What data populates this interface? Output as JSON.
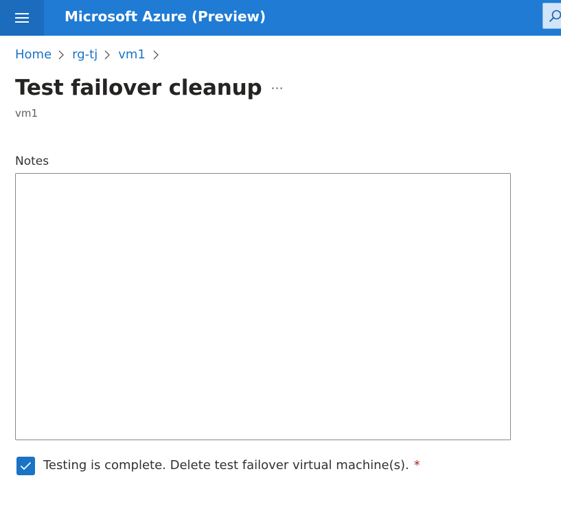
{
  "header": {
    "app_title": "Microsoft Azure (Preview)",
    "menu_icon": "hamburger-icon",
    "search_icon": "search-icon",
    "brand_color": "#1f7bd3"
  },
  "breadcrumb": {
    "items": [
      {
        "label": "Home"
      },
      {
        "label": "rg-tj"
      },
      {
        "label": "vm1"
      }
    ],
    "separator_icon": "chevron-right-icon"
  },
  "page": {
    "title": "Test failover cleanup",
    "more_label": "···",
    "subtitle": "vm1"
  },
  "form": {
    "notes_label": "Notes",
    "notes_value": "",
    "confirm_label": "Testing is complete. Delete test failover virtual machine(s).",
    "confirm_checked": true,
    "required_marker": "*",
    "accent_color": "#1a73c4",
    "required_color": "#a4262c"
  }
}
